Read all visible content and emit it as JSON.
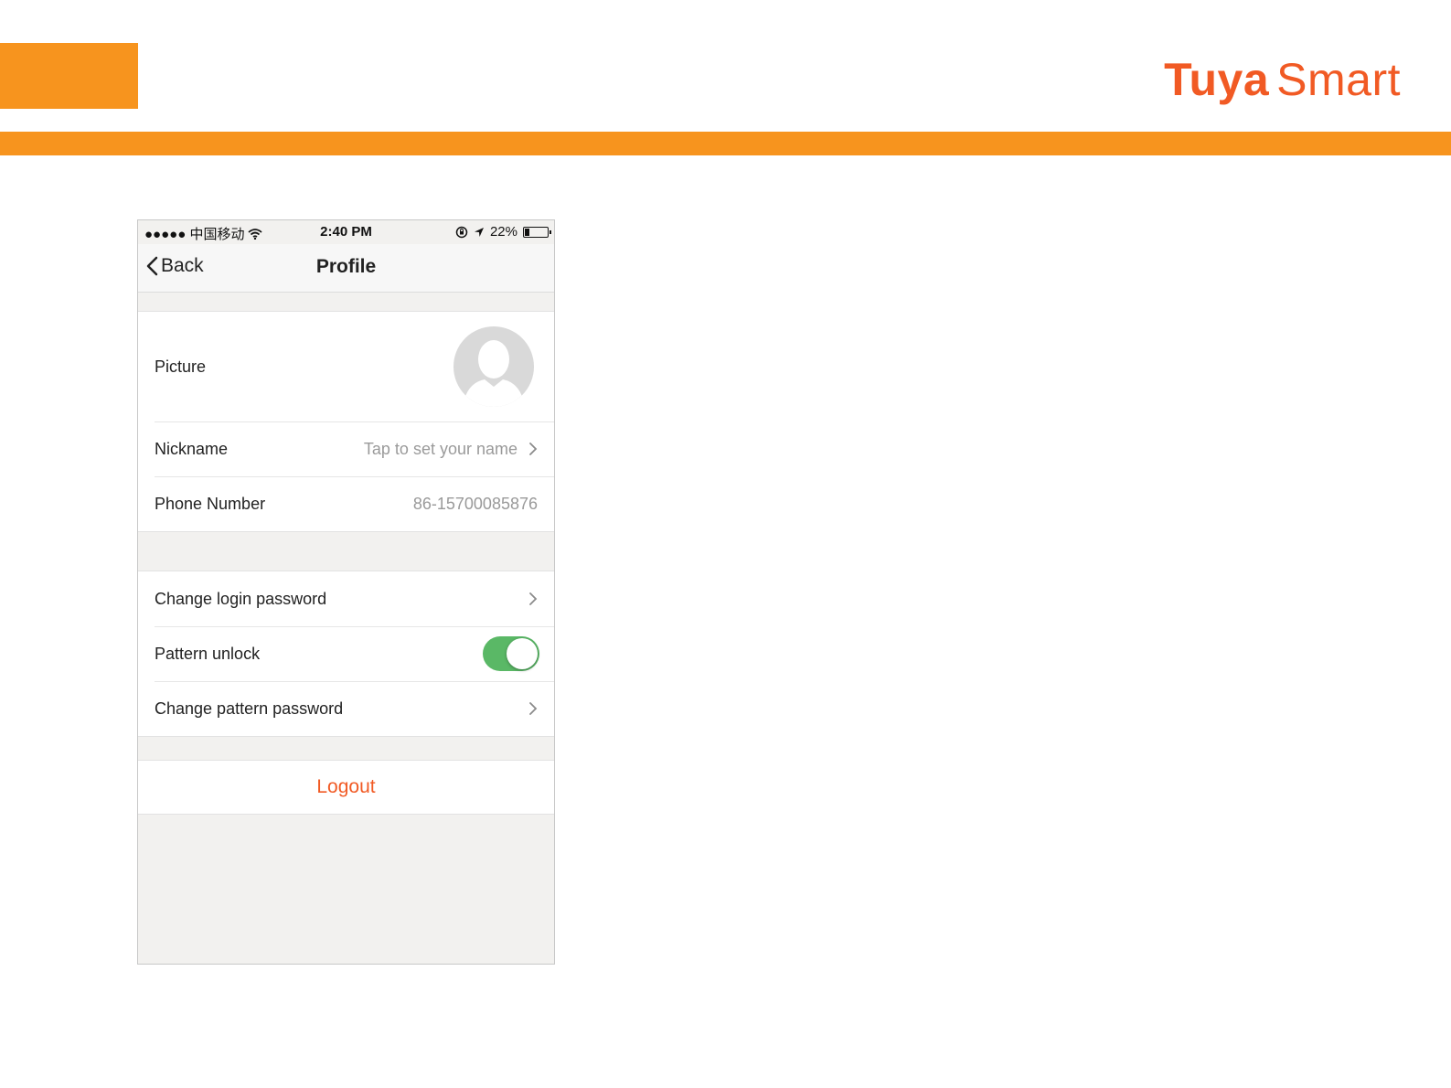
{
  "brand": {
    "part1": "Tuya",
    "part2": "Smart",
    "color": "#f15a24"
  },
  "colors": {
    "slide_accent": "#f7941e",
    "toggle_on": "#5ab866",
    "logout": "#f15a24"
  },
  "status_bar": {
    "carrier": "●●●●● 中国移动",
    "time": "2:40 PM",
    "battery": "22%",
    "icons": [
      "wifi-icon",
      "orientation-lock-icon",
      "location-icon",
      "battery-icon"
    ]
  },
  "navbar": {
    "back_label": "Back",
    "title": "Profile"
  },
  "profile": {
    "picture_label": "Picture",
    "nickname_label": "Nickname",
    "nickname_placeholder": "Tap to set your name",
    "phone_label": "Phone Number",
    "phone_value": "86-15700085876"
  },
  "security": {
    "change_login_label": "Change login password",
    "pattern_unlock_label": "Pattern unlock",
    "pattern_unlock_on": true,
    "change_pattern_label": "Change pattern password"
  },
  "logout_label": "Logout"
}
